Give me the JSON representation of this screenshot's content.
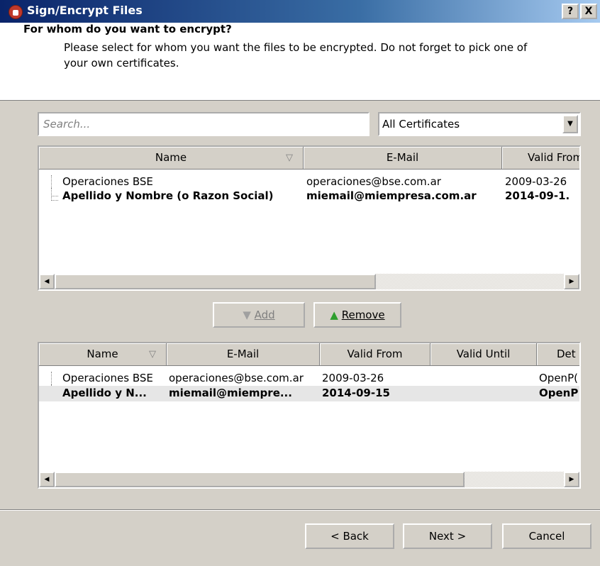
{
  "window": {
    "title": "Sign/Encrypt Files",
    "help_label": "?",
    "close_label": "X"
  },
  "header": {
    "title": "For whom do you want to encrypt?",
    "description": "Please select for whom you want the files to be encrypted. Do not forget to pick one of",
    "description2": "your own certificates."
  },
  "search": {
    "placeholder": "Search..."
  },
  "filter": {
    "selected": "All Certificates"
  },
  "available": {
    "columns": [
      "Name",
      "E-Mail",
      "Valid From"
    ],
    "rows": [
      {
        "name": "Operaciones BSE",
        "email": "operaciones@bse.com.ar",
        "valid_from": "2009-03-26"
      },
      {
        "name": "Apellido y Nombre (o Razon Social)",
        "email": "miemail@miempresa.com.ar",
        "valid_from": "2014-09-1."
      }
    ]
  },
  "actions": {
    "add_label": "Add",
    "remove_label": "Remove"
  },
  "selected": {
    "columns": [
      "Name",
      "E-Mail",
      "Valid From",
      "Valid Until",
      "Det"
    ],
    "rows": [
      {
        "name": "Operaciones BSE",
        "email": "operaciones@bse.com.ar",
        "valid_from": "2009-03-26",
        "valid_until": "",
        "details": "OpenP("
      },
      {
        "name": "Apellido y N...",
        "email": "miemail@miempre...",
        "valid_from": "2014-09-15",
        "valid_until": "",
        "details": "OpenP"
      }
    ]
  },
  "footer": {
    "back_label": "< Back",
    "next_label": "Next >",
    "cancel_label": "Cancel"
  }
}
